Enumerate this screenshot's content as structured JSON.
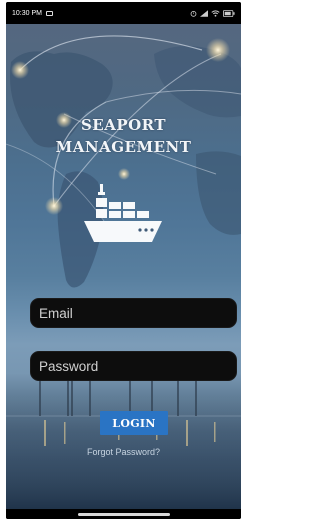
{
  "status_bar": {
    "time": "10:30 PM",
    "icons": [
      "message-icon",
      "alarm-icon",
      "signal-icon",
      "wifi-icon",
      "battery-icon"
    ]
  },
  "app": {
    "title_line1": "SEAPORT",
    "title_line2": "MANAGEMENT",
    "logo": "cargo-ship-icon"
  },
  "form": {
    "email_placeholder": "Email",
    "email_value": "",
    "password_placeholder": "Password",
    "password_value": "",
    "login_label": "LOGIN",
    "forgot_label": "Forgot Password?"
  },
  "colors": {
    "login_button": "#2a74c4",
    "field_background": "#0d0d0d",
    "title_text": "#f2f5f8"
  }
}
